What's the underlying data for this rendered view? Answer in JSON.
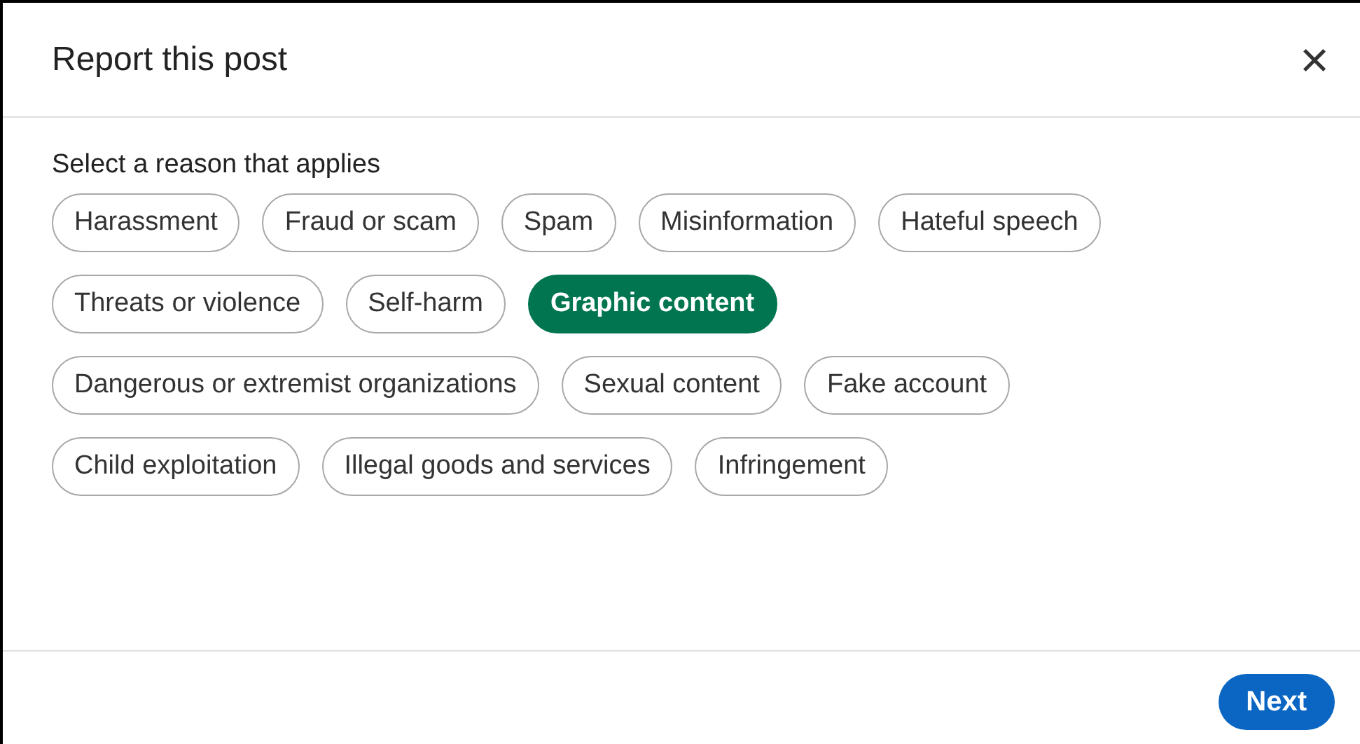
{
  "dialog": {
    "title": "Report this post",
    "close": "×"
  },
  "prompt": "Select a reason that applies",
  "reasons": [
    {
      "label": "Harassment",
      "selected": false
    },
    {
      "label": "Fraud or scam",
      "selected": false
    },
    {
      "label": "Spam",
      "selected": false
    },
    {
      "label": "Misinformation",
      "selected": false
    },
    {
      "label": "Hateful speech",
      "selected": false
    },
    {
      "label": "Threats or violence",
      "selected": false
    },
    {
      "label": "Self-harm",
      "selected": false
    },
    {
      "label": "Graphic content",
      "selected": true
    },
    {
      "label": "Dangerous or extremist organizations",
      "selected": false
    },
    {
      "label": "Sexual content",
      "selected": false
    },
    {
      "label": "Fake account",
      "selected": false
    },
    {
      "label": "Child exploitation",
      "selected": false
    },
    {
      "label": "Illegal goods and services",
      "selected": false
    },
    {
      "label": "Infringement",
      "selected": false
    }
  ],
  "buttons": [
    "Next"
  ]
}
